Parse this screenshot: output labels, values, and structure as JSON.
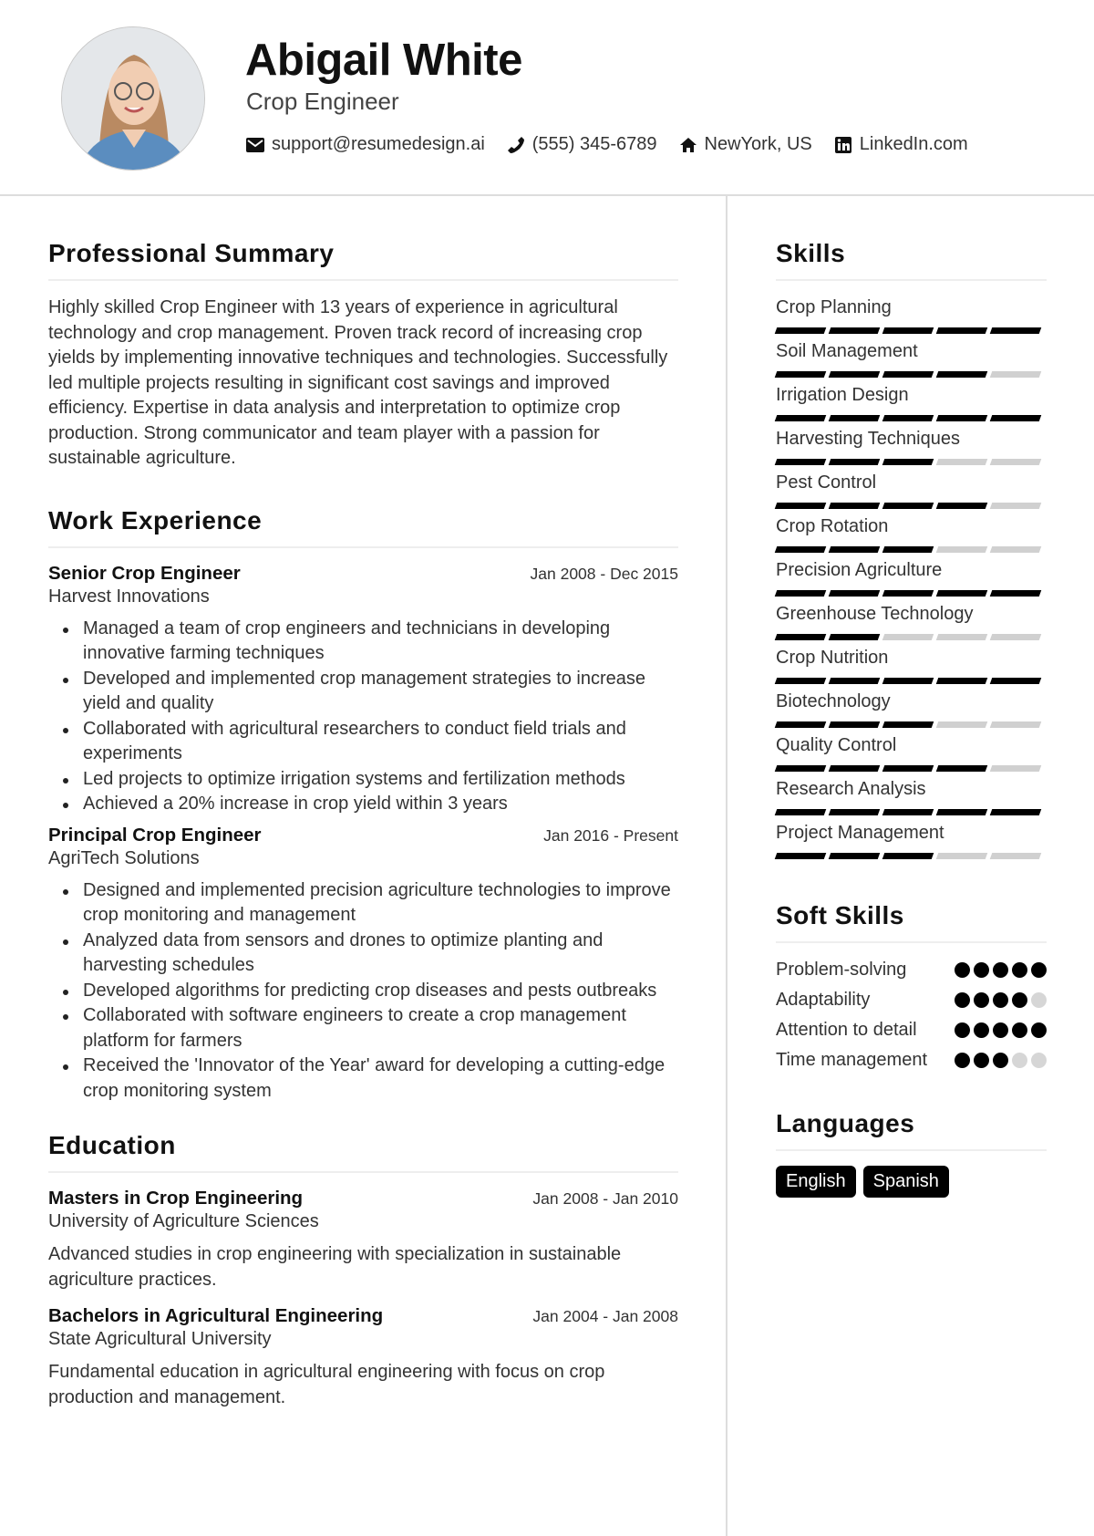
{
  "header": {
    "name": "Abigail White",
    "title": "Crop Engineer",
    "contacts": [
      {
        "icon": "envelope-icon",
        "text": "support@resumedesign.ai"
      },
      {
        "icon": "phone-icon",
        "text": "(555) 345-6789"
      },
      {
        "icon": "home-icon",
        "text": "NewYork, US"
      },
      {
        "icon": "linkedin-icon",
        "text": "LinkedIn.com"
      }
    ]
  },
  "summary": {
    "title": "Professional Summary",
    "text": "Highly skilled Crop Engineer with 13 years of experience in agricultural technology and crop management. Proven track record of increasing crop yields by implementing innovative techniques and technologies. Successfully led multiple projects resulting in significant cost savings and improved efficiency. Expertise in data analysis and interpretation to optimize crop production. Strong communicator and team player with a passion for sustainable agriculture."
  },
  "experience": {
    "title": "Work Experience",
    "jobs": [
      {
        "role": "Senior Crop Engineer",
        "dates": "Jan 2008 - Dec 2015",
        "company": "Harvest Innovations",
        "bullets": [
          "Managed a team of crop engineers and technicians in developing innovative farming techniques",
          "Developed and implemented crop management strategies to increase yield and quality",
          "Collaborated with agricultural researchers to conduct field trials and experiments",
          "Led projects to optimize irrigation systems and fertilization methods",
          "Achieved a 20% increase in crop yield within 3 years"
        ]
      },
      {
        "role": "Principal Crop Engineer",
        "dates": "Jan 2016 - Present",
        "company": "AgriTech Solutions",
        "bullets": [
          "Designed and implemented precision agriculture technologies to improve crop monitoring and management",
          "Analyzed data from sensors and drones to optimize planting and harvesting schedules",
          "Developed algorithms for predicting crop diseases and pests outbreaks",
          "Collaborated with software engineers to create a crop management platform for farmers",
          "Received the 'Innovator of the Year' award for developing a cutting-edge crop monitoring system"
        ]
      }
    ]
  },
  "education": {
    "title": "Education",
    "items": [
      {
        "degree": "Masters in Crop Engineering",
        "dates": "Jan 2008 - Jan 2010",
        "school": "University of Agriculture Sciences",
        "desc": "Advanced studies in crop engineering with specialization in sustainable agriculture practices."
      },
      {
        "degree": "Bachelors in Agricultural Engineering",
        "dates": "Jan 2004 - Jan 2008",
        "school": "State Agricultural University",
        "desc": "Fundamental education in agricultural engineering with focus on crop production and management."
      }
    ]
  },
  "skills": {
    "title": "Skills",
    "max": 5,
    "items": [
      {
        "name": "Crop Planning",
        "level": 5
      },
      {
        "name": "Soil Management",
        "level": 4
      },
      {
        "name": "Irrigation Design",
        "level": 5
      },
      {
        "name": "Harvesting Techniques",
        "level": 3
      },
      {
        "name": "Pest Control",
        "level": 4
      },
      {
        "name": "Crop Rotation",
        "level": 3
      },
      {
        "name": "Precision Agriculture",
        "level": 5
      },
      {
        "name": "Greenhouse Technology",
        "level": 2
      },
      {
        "name": "Crop Nutrition",
        "level": 5
      },
      {
        "name": "Biotechnology",
        "level": 3
      },
      {
        "name": "Quality Control",
        "level": 4
      },
      {
        "name": "Research Analysis",
        "level": 5
      },
      {
        "name": "Project Management",
        "level": 3
      }
    ]
  },
  "soft_skills": {
    "title": "Soft Skills",
    "max": 5,
    "items": [
      {
        "name": "Problem-solving",
        "level": 5
      },
      {
        "name": "Adaptability",
        "level": 4
      },
      {
        "name": "Attention to detail",
        "level": 5
      },
      {
        "name": "Time management",
        "level": 3
      }
    ]
  },
  "languages": {
    "title": "Languages",
    "items": [
      "English",
      "Spanish"
    ]
  }
}
